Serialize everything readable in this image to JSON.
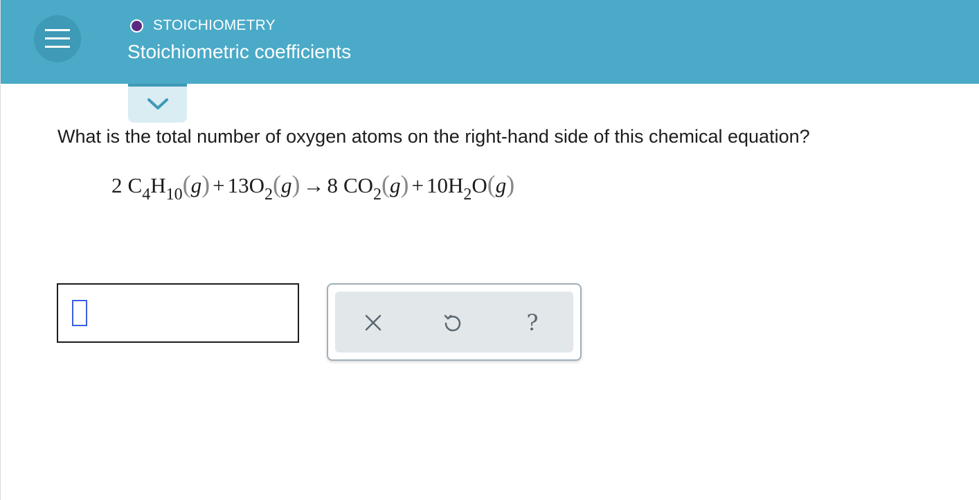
{
  "header": {
    "topic_label": "STOICHIOMETRY",
    "page_title": "Stoichiometric coefficients"
  },
  "question": {
    "text": "What is the total number of oxygen atoms on the right-hand side of this chemical equation?"
  },
  "equation": {
    "r1_coef": "2",
    "r1_el1": "C",
    "r1_sub1": "4",
    "r1_el2": "H",
    "r1_sub2": "10",
    "state": "g",
    "plus": "+",
    "r2_coef": "13",
    "r2_el": "O",
    "r2_sub": "2",
    "arrow": "→",
    "p1_coef": "8",
    "p1_el": "CO",
    "p1_sub": "2",
    "p2_coef": "10",
    "p2_el1": "H",
    "p2_sub": "2",
    "p2_el2": "O"
  },
  "answer": {
    "value": ""
  },
  "tools": {
    "clear_icon": "x-icon",
    "undo_icon": "undo-icon",
    "help_icon": "question-mark-icon",
    "help_glyph": "?"
  },
  "colors": {
    "header_bg": "#4aaac8",
    "topic_dot": "#5a2a82",
    "cursor": "#3a5ee0"
  }
}
